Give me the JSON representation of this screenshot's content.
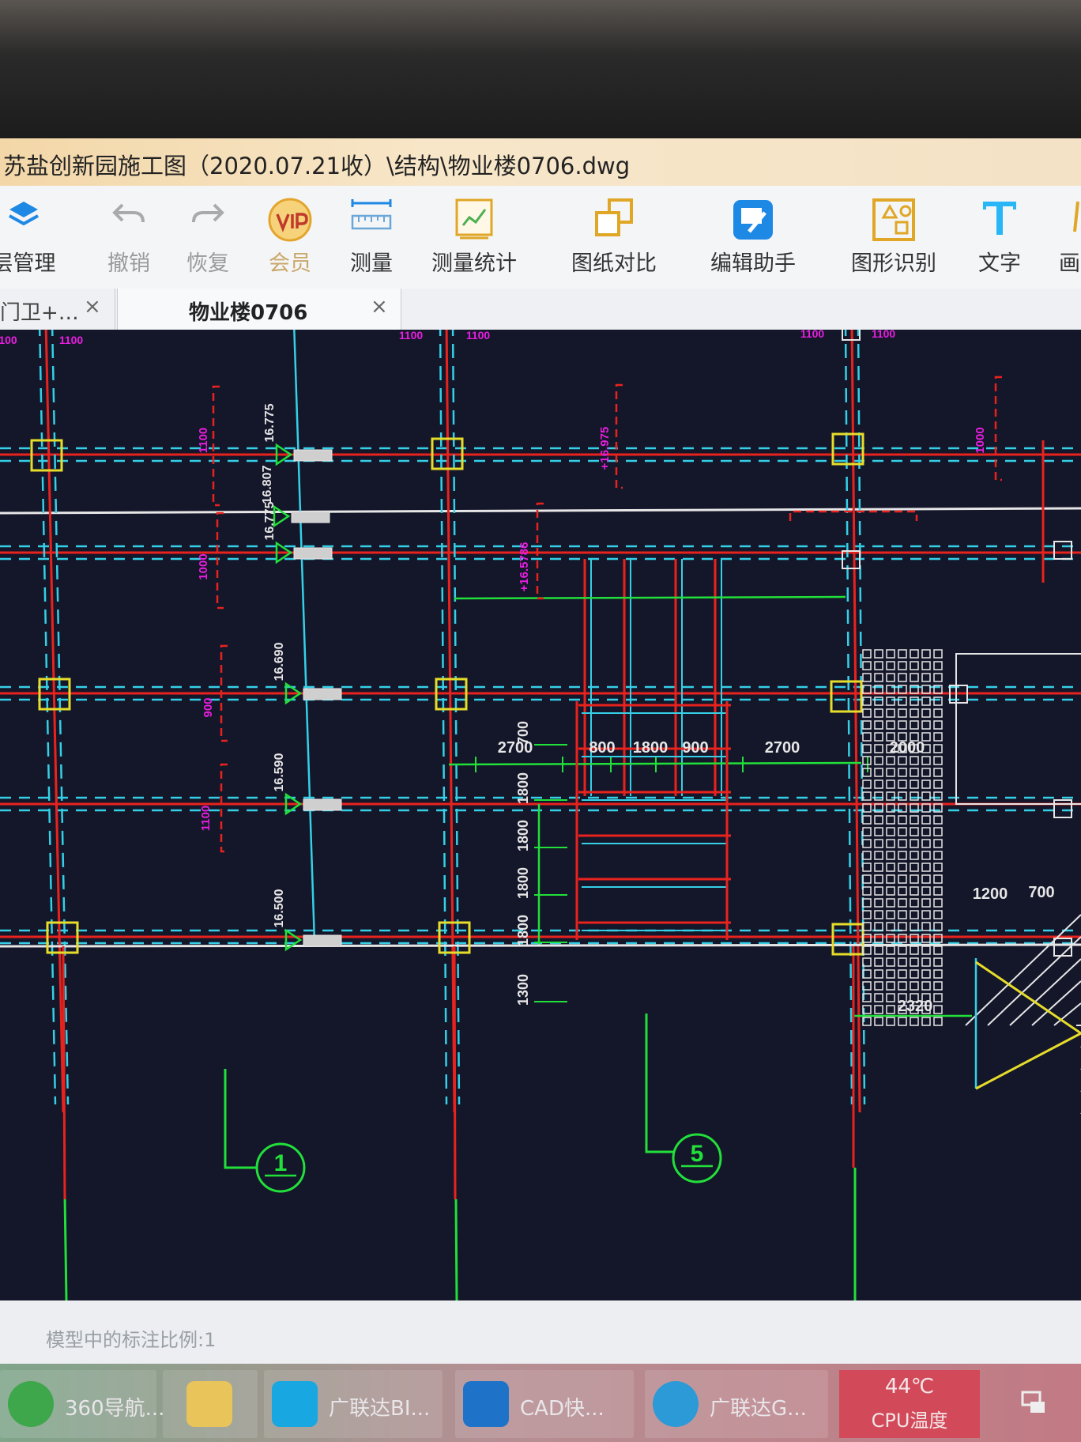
{
  "window": {
    "title": "苏盐创新园施工图（2020.07.21收）\\结构\\物业楼0706.dwg"
  },
  "toolbar": {
    "items": [
      {
        "label": "层管理",
        "icon": "layers-icon"
      },
      {
        "label": "撤销",
        "icon": "undo-icon"
      },
      {
        "label": "恢复",
        "icon": "redo-icon"
      },
      {
        "label": "会员",
        "icon": "vip-icon"
      },
      {
        "label": "测量",
        "icon": "ruler-icon"
      },
      {
        "label": "测量统计",
        "icon": "measure-stats-icon"
      },
      {
        "label": "图纸对比",
        "icon": "compare-icon"
      },
      {
        "label": "编辑助手",
        "icon": "cad-edit-icon"
      },
      {
        "label": "图形识别",
        "icon": "shape-recognize-icon"
      },
      {
        "label": "文字",
        "icon": "text-icon"
      },
      {
        "label": "画",
        "icon": "draw-icon"
      }
    ]
  },
  "tabs": [
    {
      "label": "门卫+…",
      "close": "×"
    },
    {
      "label": "物业楼0706",
      "close": "×"
    }
  ],
  "drawing": {
    "colors": {
      "background": "#14162a",
      "red": "#e8231e",
      "cyan": "#35d0e6",
      "yellow": "#e6dd2a",
      "green": "#22e03a",
      "magenta": "#e91ee0",
      "white": "#e6e6e6"
    },
    "top_dims": [
      "100",
      "1100",
      "1100",
      "1100",
      "1100",
      "1100"
    ],
    "elevations": [
      "16.775",
      "16.807",
      "16.775",
      "16.690",
      "16.590",
      "16.500"
    ],
    "horizontal_dims": [
      "2700",
      "800",
      "1800",
      "900",
      "2700",
      "2000"
    ],
    "stair_dims": [
      "700",
      "1800",
      "1800",
      "1800",
      "1800",
      "1300"
    ],
    "right_dims": [
      "1200",
      "700",
      "2320"
    ],
    "magenta_labels": [
      "1100",
      "+16.975",
      "1000",
      "1000",
      "+16.5786",
      "900"
    ],
    "axis_labels": [
      "1",
      "5"
    ]
  },
  "status": {
    "text": "模型中的标注比例:1"
  },
  "taskbar": {
    "items": [
      {
        "label": "360导航..."
      },
      {
        "label": ""
      },
      {
        "label": "广联达BI..."
      },
      {
        "label": "CAD快..."
      },
      {
        "label": "广联达G..."
      }
    ],
    "cpu_temp": "44℃",
    "cpu_label": "CPU温度"
  }
}
